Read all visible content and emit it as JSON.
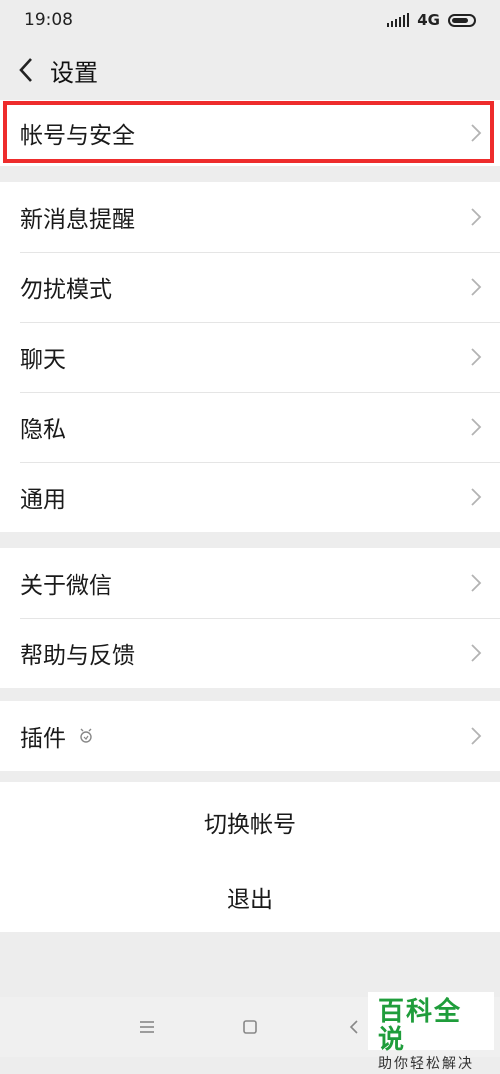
{
  "status": {
    "time": "19:08",
    "network": "4G"
  },
  "header": {
    "title": "设置"
  },
  "groups": {
    "account": [
      "帐号与安全"
    ],
    "main": [
      "新消息提醒",
      "勿扰模式",
      "聊天",
      "隐私",
      "通用"
    ],
    "about": [
      "关于微信",
      "帮助与反馈"
    ],
    "plugins": [
      "插件"
    ]
  },
  "actions": {
    "switch_account": "切换帐号",
    "logout": "退出"
  },
  "watermark": {
    "title": "百科全说",
    "subtitle": "助你轻松解决"
  },
  "colors": {
    "highlight": "#ee2c2c",
    "watermark_green": "#1f9d3b"
  }
}
